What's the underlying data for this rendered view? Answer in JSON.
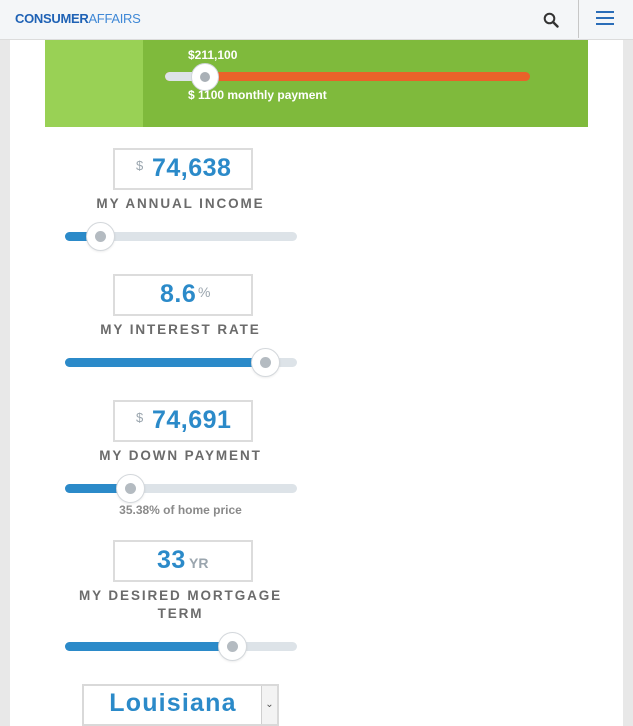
{
  "header": {
    "logo_part1": "CONSUMER",
    "logo_part2": "AFFAIRS",
    "search_icon": "search-icon",
    "menu_icon": "hamburger-menu-icon"
  },
  "banner": {
    "home_price": "$211,100",
    "monthly_payment": "$ 1100 monthly payment",
    "slider_fraction": 0.11
  },
  "income": {
    "currency": "$",
    "value": "74,638",
    "label": "MY ANNUAL INCOME",
    "slider_fraction": 0.15
  },
  "interest": {
    "value": "8.6",
    "suffix": "%",
    "label": "MY INTEREST RATE",
    "slider_fraction": 0.86
  },
  "down_payment": {
    "currency": "$",
    "value": "74,691",
    "label": "MY DOWN PAYMENT",
    "note": "35.38% of home price",
    "slider_fraction": 0.28
  },
  "term": {
    "value": "33",
    "suffix": "YR",
    "label_line1": "MY DESIRED MORTGAGE",
    "label_line2": "TERM",
    "slider_fraction": 0.72
  },
  "state": {
    "selected": "Louisiana"
  },
  "colors": {
    "brand_blue": "#1f62b5",
    "value_blue": "#2b8ac9",
    "banner_green": "#7fba3c",
    "banner_light_green": "#99d155",
    "banner_orange": "#e9622a"
  }
}
